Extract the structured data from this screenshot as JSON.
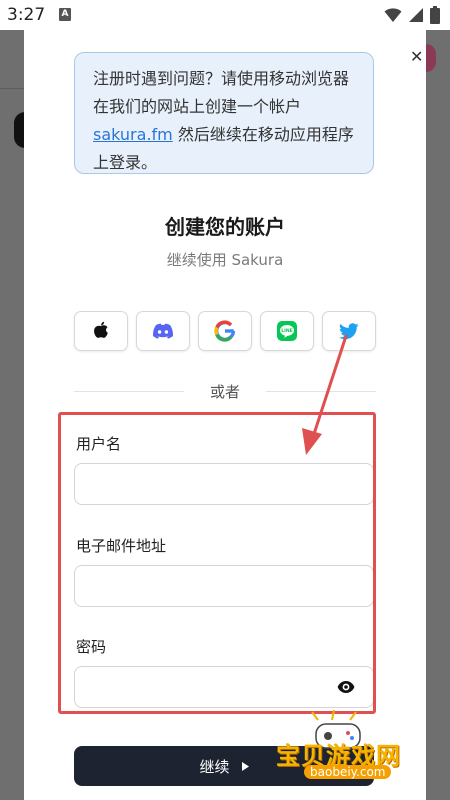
{
  "status_bar": {
    "time": "3:27",
    "notification_badge": "A"
  },
  "notice": {
    "text_before": "注册时遇到问题？请使用移动浏览器在我们的网站上创建一个帐户",
    "link_text": "sakura.fm",
    "text_after": " 然后继续在移动应用程序上登录。"
  },
  "title": "创建您的账户",
  "subtitle": "继续使用 Sakura",
  "social_buttons": [
    {
      "icon": "apple-icon"
    },
    {
      "icon": "discord-icon",
      "color": "#5865F2"
    },
    {
      "icon": "google-icon"
    },
    {
      "icon": "line-icon",
      "color": "#06C755"
    },
    {
      "icon": "twitter-icon",
      "color": "#1DA1F2"
    }
  ],
  "divider_text": "或者",
  "form": {
    "username_label": "用户名",
    "email_label": "电子邮件地址",
    "password_label": "密码"
  },
  "continue_label": "继续",
  "watermark": {
    "text": "宝贝游戏网",
    "url": "baobeiy.com"
  },
  "colors": {
    "annotation": "#e05050",
    "link": "#2a74d8",
    "button": "#1d2330"
  }
}
